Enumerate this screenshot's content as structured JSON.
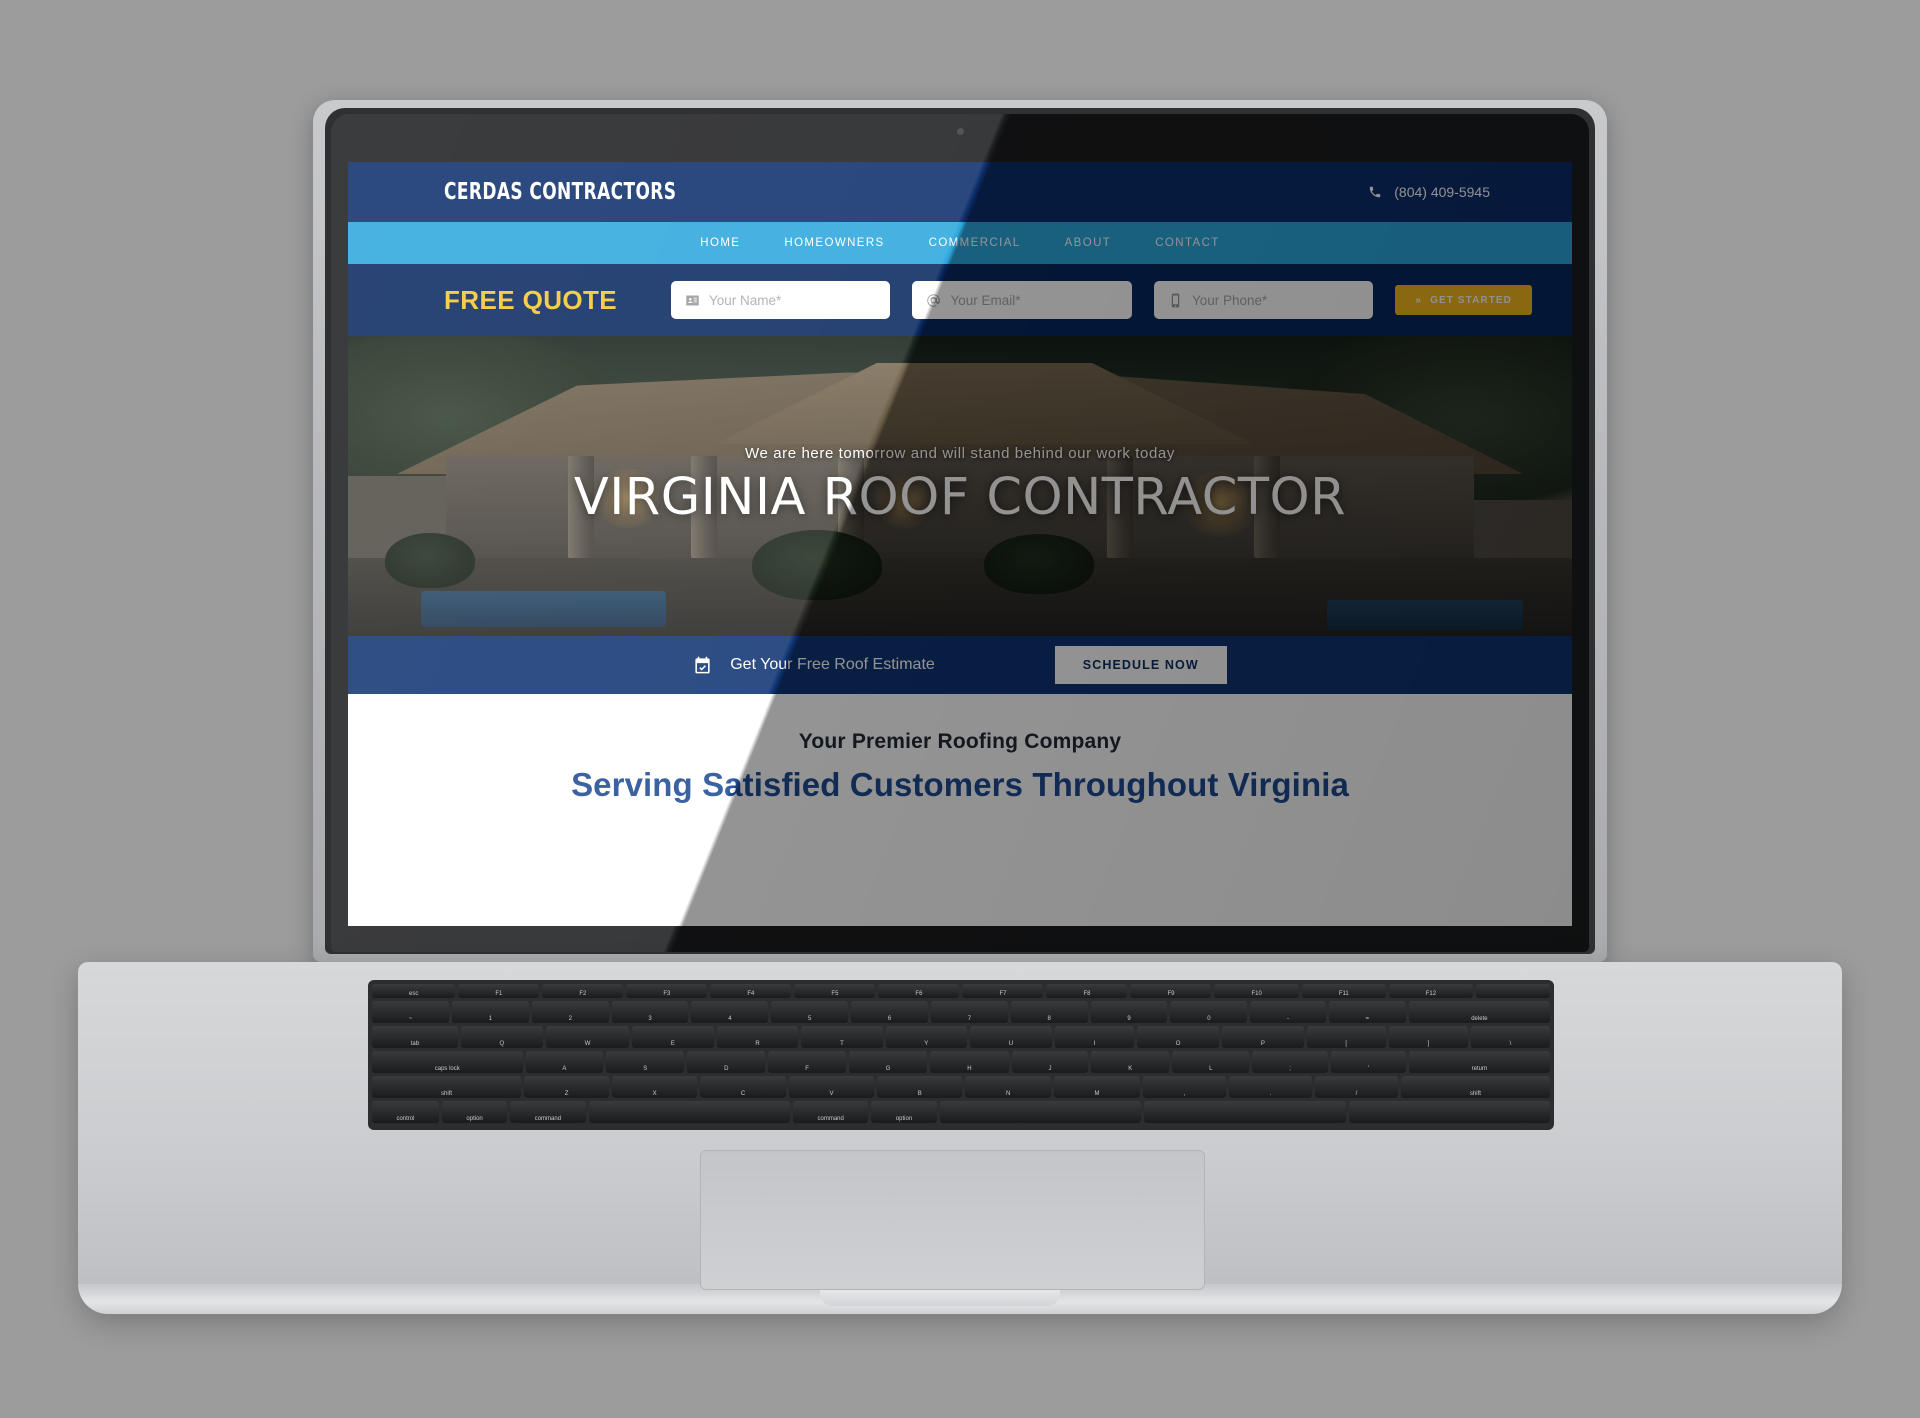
{
  "device": {
    "type": "laptop-mockup"
  },
  "site": {
    "topbar": {
      "logo": "CERDAS CONTRACTORS",
      "phone_icon": "phone-icon",
      "phone": "(804) 409-5945"
    },
    "nav": {
      "items": [
        {
          "label": "HOME"
        },
        {
          "label": "HOMEOWNERS"
        },
        {
          "label": "COMMERCIAL"
        },
        {
          "label": "ABOUT"
        },
        {
          "label": "CONTACT"
        }
      ]
    },
    "quote_bar": {
      "title": "FREE QUOTE",
      "name_icon": "contact-card-icon",
      "name_placeholder": "Your Name*",
      "name_value": "",
      "email_icon": "at-sign-icon",
      "email_placeholder": "Your Email*",
      "email_value": "",
      "phone_icon": "mobile-phone-icon",
      "phone_placeholder": "Your Phone*",
      "phone_value": "",
      "submit_chevron": "»",
      "submit_label": "GET STARTED"
    },
    "hero": {
      "tagline": "We are here tomorrow and will stand behind our work today",
      "heading": "VIRGINIA ROOF CONTRACTOR"
    },
    "cta_bar": {
      "icon": "calendar-check-icon",
      "text": "Get Your Free Roof Estimate",
      "button_label": "SCHEDULE NOW"
    },
    "white_section": {
      "kicker": "Your Premier Roofing Company",
      "heading": "Serving Satisfied Customers Throughout Virginia"
    },
    "colors": {
      "topbar_blue": "#0b2d6b",
      "nav_blue": "#2ba6dc",
      "quote_blue": "#07275f",
      "accent_yellow": "#f5b91b",
      "heading_blue": "#1e4b93",
      "page_background": "#9c9c9c"
    }
  },
  "keyboard": {
    "fn_row": [
      "esc",
      "F1",
      "F2",
      "F3",
      "F4",
      "F5",
      "F6",
      "F7",
      "F8",
      "F9",
      "F10",
      "F11",
      "F12",
      ""
    ],
    "num_row": [
      "~",
      "1",
      "2",
      "3",
      "4",
      "5",
      "6",
      "7",
      "8",
      "9",
      "0",
      "-",
      "=",
      "delete"
    ],
    "q_row": [
      "tab",
      "Q",
      "W",
      "E",
      "R",
      "T",
      "Y",
      "U",
      "I",
      "O",
      "P",
      "[",
      "]",
      "\\"
    ],
    "a_row": [
      "caps lock",
      "A",
      "S",
      "D",
      "F",
      "G",
      "H",
      "J",
      "K",
      "L",
      ";",
      "'",
      "return"
    ],
    "z_row": [
      "shift",
      "Z",
      "X",
      "C",
      "V",
      "B",
      "N",
      "M",
      ",",
      ".",
      "/",
      "shift"
    ],
    "mod_row": [
      "control",
      "option",
      "command",
      "",
      "command",
      "option",
      "",
      "",
      ""
    ]
  }
}
